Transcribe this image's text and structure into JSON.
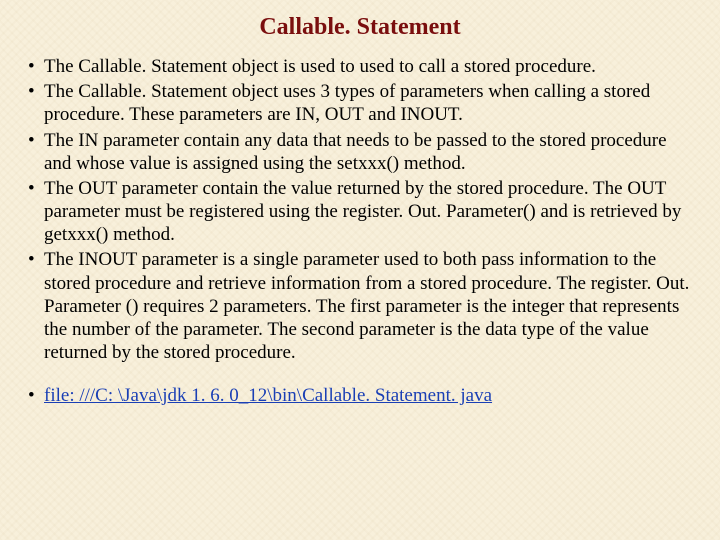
{
  "title": "Callable. Statement",
  "bullets": [
    "The Callable. Statement object is used to used to call a stored procedure.",
    "The Callable. Statement object uses 3 types of parameters when calling a stored procedure. These parameters are IN, OUT and INOUT.",
    "The IN parameter contain any data that needs to be passed to the  stored procedure and whose value  is assigned using the setxxx() method.",
    "The OUT parameter  contain the value returned by the stored procedure. The OUT parameter must be registered using the register. Out. Parameter() and is retrieved by getxxx() method.",
    "The INOUT parameter is a single parameter used to both pass information to the stored procedure and retrieve information from a stored procedure.  The  register. Out. Parameter () requires 2 parameters. The first parameter is the integer that represents the number of the parameter. The second parameter is the data type of the value returned by the stored procedure."
  ],
  "link_text": "file: ///C: \\Java\\jdk 1. 6. 0_12\\bin\\Callable. Statement. java"
}
